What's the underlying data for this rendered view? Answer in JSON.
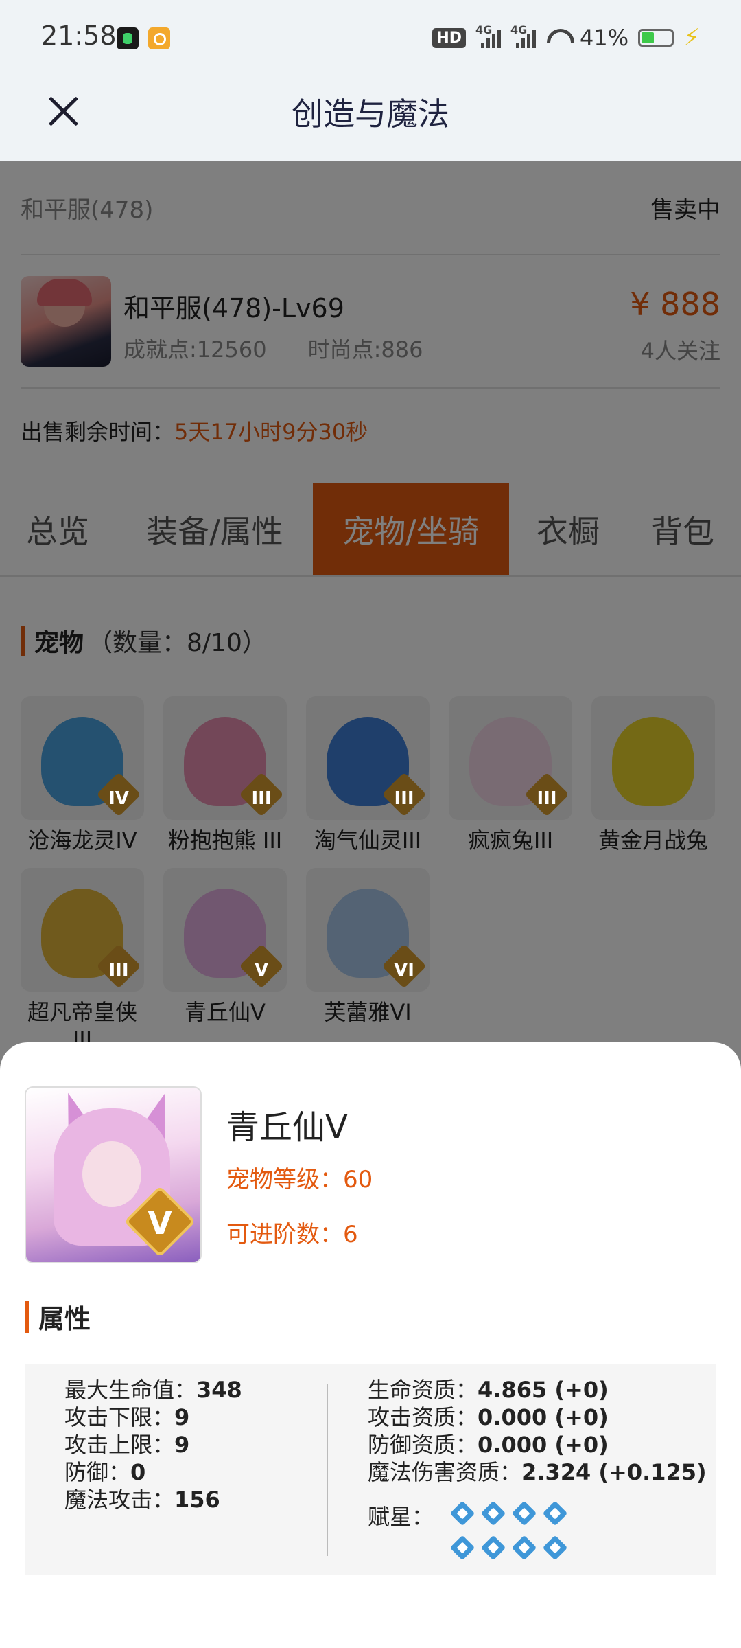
{
  "status_bar": {
    "time": "21:58",
    "hd_label": "HD",
    "net1": "4G",
    "net2": "4G",
    "battery": "41%"
  },
  "header": {
    "title": "创造与魔法"
  },
  "listing": {
    "server": "和平服(478)",
    "status": "售卖中",
    "character_name": "和平服(478)-Lv69",
    "achievement": "成就点:12560",
    "fashion": "时尚点:886",
    "price": "¥ 888",
    "followers": "4人关注",
    "remaining_label": "出售剩余时间：",
    "remaining_value": "5天17小时9分30秒"
  },
  "tabs": [
    {
      "label": "总览"
    },
    {
      "label": "装备/属性"
    },
    {
      "label": "宠物/坐骑",
      "active": true
    },
    {
      "label": "衣橱"
    },
    {
      "label": "背包"
    }
  ],
  "pets_section": {
    "title": "宠物",
    "count": "（数量：8/10）",
    "items": [
      {
        "name": "沧海龙灵IV",
        "badge": "IV",
        "color": "#4aa3e0"
      },
      {
        "name": "粉抱抱熊 III",
        "badge": "III",
        "color": "#e68fb0"
      },
      {
        "name": "淘气仙灵III",
        "badge": "III",
        "color": "#3e7fd6"
      },
      {
        "name": "疯疯兔III",
        "badge": "III",
        "color": "#f2d6e6"
      },
      {
        "name": "黄金月战兔",
        "badge": "",
        "color": "#e8d22a"
      },
      {
        "name": "超凡帝皇侠III",
        "badge": "III",
        "color": "#e0b43a"
      },
      {
        "name": "青丘仙V",
        "badge": "V",
        "color": "#e2aee0"
      },
      {
        "name": "芙蕾雅VI",
        "badge": "VI",
        "color": "#a8c6e8"
      }
    ]
  },
  "detail": {
    "name": "青丘仙V",
    "badge": "V",
    "level": "宠物等级：60",
    "advance": "可进阶数：6",
    "attr_title": "属性",
    "left": [
      {
        "label": "最大生命值：",
        "value": "348"
      },
      {
        "label": "攻击下限：",
        "value": "9"
      },
      {
        "label": "攻击上限：",
        "value": "9"
      },
      {
        "label": "防御：",
        "value": "0"
      },
      {
        "label": "魔法攻击：",
        "value": "156"
      }
    ],
    "right": [
      {
        "label": "生命资质：",
        "value": "4.865 (+0)"
      },
      {
        "label": "攻击资质：",
        "value": "0.000 (+0)"
      },
      {
        "label": "防御资质：",
        "value": "0.000 (+0)"
      },
      {
        "label": "魔法伤害资质：",
        "value": "2.324 (+0.125)"
      }
    ],
    "stars_label": "赋星：",
    "star_count": 8
  }
}
